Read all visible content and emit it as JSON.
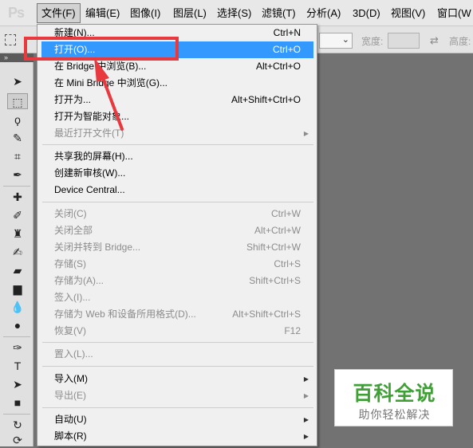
{
  "app": {
    "logo": "Ps"
  },
  "menubar": {
    "items": [
      {
        "label": "文件(F)",
        "active": true
      },
      {
        "label": "编辑(E)"
      },
      {
        "label": "图像(I)"
      },
      {
        "label": "图层(L)"
      },
      {
        "label": "选择(S)"
      },
      {
        "label": "滤镜(T)"
      },
      {
        "label": "分析(A)"
      },
      {
        "label": "3D(D)"
      },
      {
        "label": "视图(V)"
      },
      {
        "label": "窗口(W"
      }
    ]
  },
  "options": {
    "width_label": "宽度:",
    "height_label": "高度:"
  },
  "file_menu": {
    "items": [
      {
        "label": "新建(N)...",
        "shortcut": "Ctrl+N"
      },
      {
        "label": "打开(O)...",
        "shortcut": "Ctrl+O",
        "highlighted": true
      },
      {
        "label": "在 Bridge 中浏览(B)...",
        "shortcut": "Alt+Ctrl+O"
      },
      {
        "label": "在 Mini Bridge 中浏览(G)...",
        "shortcut": ""
      },
      {
        "label": "打开为...",
        "shortcut": "Alt+Shift+Ctrl+O"
      },
      {
        "label": "打开为智能对象...",
        "shortcut": ""
      },
      {
        "label": "最近打开文件(T)",
        "shortcut": "",
        "disabled": true,
        "submenu": true
      },
      {
        "label": "共享我的屏幕(H)...",
        "shortcut": ""
      },
      {
        "label": "创建新审核(W)...",
        "shortcut": ""
      },
      {
        "label": "Device Central...",
        "shortcut": ""
      },
      {
        "label": "关闭(C)",
        "shortcut": "Ctrl+W",
        "disabled": true
      },
      {
        "label": "关闭全部",
        "shortcut": "Alt+Ctrl+W",
        "disabled": true
      },
      {
        "label": "关闭并转到 Bridge...",
        "shortcut": "Shift+Ctrl+W",
        "disabled": true
      },
      {
        "label": "存储(S)",
        "shortcut": "Ctrl+S",
        "disabled": true
      },
      {
        "label": "存储为(A)...",
        "shortcut": "Shift+Ctrl+S",
        "disabled": true
      },
      {
        "label": "签入(I)...",
        "shortcut": "",
        "disabled": true
      },
      {
        "label": "存储为 Web 和设备所用格式(D)...",
        "shortcut": "Alt+Shift+Ctrl+S",
        "disabled": true
      },
      {
        "label": "恢复(V)",
        "shortcut": "F12",
        "disabled": true
      },
      {
        "label": "置入(L)...",
        "shortcut": "",
        "disabled": true
      },
      {
        "label": "导入(M)",
        "shortcut": "",
        "submenu": true
      },
      {
        "label": "导出(E)",
        "shortcut": "",
        "disabled": true,
        "submenu": true
      },
      {
        "label": "自动(U)",
        "shortcut": "",
        "submenu": true
      },
      {
        "label": "脚本(R)",
        "shortcut": "",
        "submenu": true
      }
    ]
  },
  "watermark": {
    "title": "百科全说",
    "subtitle": "助你轻松解决"
  },
  "colors": {
    "highlight": "#3399ff",
    "annotation": "#e8393f",
    "watermark_green": "#3ea035"
  }
}
